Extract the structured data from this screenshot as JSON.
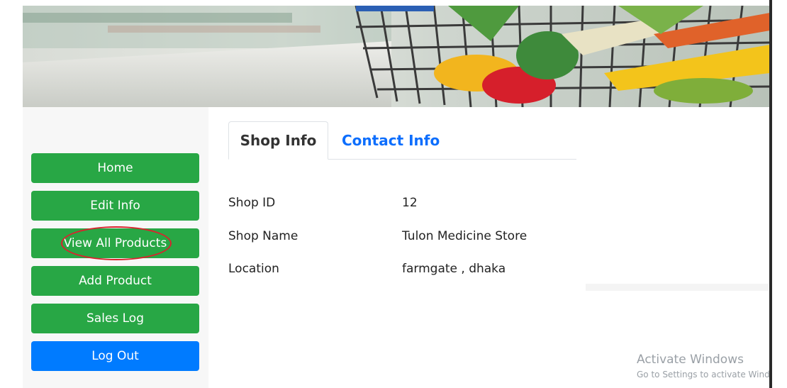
{
  "sidebar": {
    "items": [
      {
        "label": "Home"
      },
      {
        "label": "Edit Info"
      },
      {
        "label": "View All Products"
      },
      {
        "label": "Add Product"
      },
      {
        "label": "Sales Log"
      },
      {
        "label": "Log Out"
      }
    ]
  },
  "tabs": [
    {
      "label": "Shop Info"
    },
    {
      "label": "Contact Info"
    }
  ],
  "shop": {
    "rows": [
      {
        "label": "Shop ID",
        "value": "12"
      },
      {
        "label": "Shop Name",
        "value": "Tulon Medicine Store"
      },
      {
        "label": "Location",
        "value": "farmgate , dhaka"
      }
    ]
  },
  "watermark": {
    "title": "Activate Windows",
    "subtitle": "Go to Settings to activate Windows."
  },
  "colors": {
    "nav_green": "#28a745",
    "logout_blue": "#007bff",
    "tab_link_blue": "#0d6efd",
    "annotation_red": "#d9232d"
  }
}
